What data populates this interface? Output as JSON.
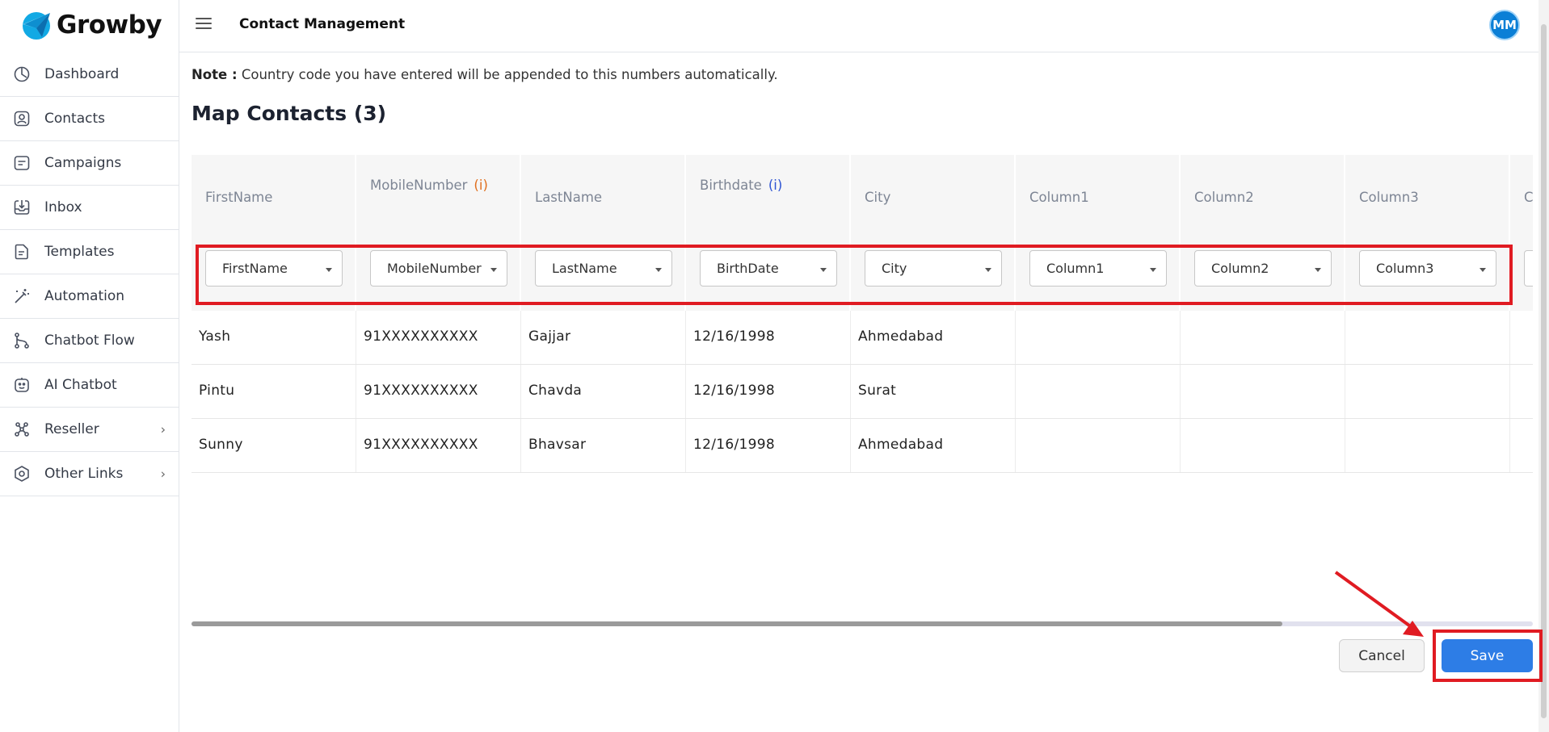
{
  "app": {
    "logo_text": "Growby",
    "header_title": "Contact Management",
    "avatar_initials": "MM"
  },
  "sidebar": {
    "items": [
      {
        "label": "Dashboard",
        "icon": "dashboard-icon"
      },
      {
        "label": "Contacts",
        "icon": "contacts-icon"
      },
      {
        "label": "Campaigns",
        "icon": "campaigns-icon"
      },
      {
        "label": "Inbox",
        "icon": "inbox-icon"
      },
      {
        "label": "Templates",
        "icon": "templates-icon"
      },
      {
        "label": "Automation",
        "icon": "automation-icon"
      },
      {
        "label": "Chatbot Flow",
        "icon": "chatbot-flow-icon"
      },
      {
        "label": "AI Chatbot",
        "icon": "ai-chatbot-icon"
      },
      {
        "label": "Reseller",
        "icon": "reseller-icon",
        "chevron": "›"
      },
      {
        "label": "Other Links",
        "icon": "other-links-icon",
        "chevron": "›"
      }
    ]
  },
  "main": {
    "note_bold": "Note :",
    "note_text": " Country code you have entered will be appended to this numbers automatically.",
    "title": "Map Contacts (3)",
    "headers": [
      {
        "label": "FirstName",
        "info": ""
      },
      {
        "label": "MobileNumber",
        "info": "(i)"
      },
      {
        "label": "LastName",
        "info": ""
      },
      {
        "label": "Birthdate",
        "info": "(i)"
      },
      {
        "label": "City",
        "info": ""
      },
      {
        "label": "Column1",
        "info": ""
      },
      {
        "label": "Column2",
        "info": ""
      },
      {
        "label": "Column3",
        "info": ""
      },
      {
        "label": "C",
        "info": ""
      }
    ],
    "mappings": [
      "FirstName",
      "MobileNumber",
      "LastName",
      "BirthDate",
      "City",
      "Column1",
      "Column2",
      "Column3",
      ""
    ],
    "rows": [
      [
        "Yash",
        "91XXXXXXXXXX",
        "Gajjar",
        "12/16/1998",
        "Ahmedabad",
        "",
        "",
        "",
        ""
      ],
      [
        "Pintu",
        "91XXXXXXXXXX",
        "Chavda",
        "12/16/1998",
        "Surat",
        "",
        "",
        "",
        ""
      ],
      [
        "Sunny",
        "91XXXXXXXXXX",
        "Bhavsar",
        "12/16/1998",
        "Ahmedabad",
        "",
        "",
        "",
        ""
      ]
    ],
    "cancel_label": "Cancel",
    "save_label": "Save"
  },
  "colors": {
    "primary": "#2d7de6",
    "highlight": "#e01b22",
    "avatar": "#0b7fd6"
  }
}
